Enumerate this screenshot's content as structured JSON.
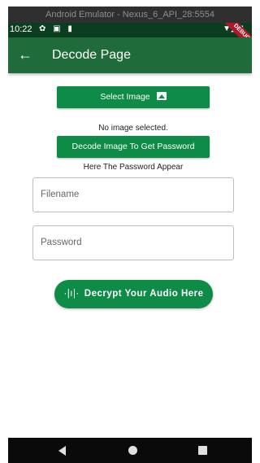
{
  "emulator": {
    "title": "Android Emulator - Nexus_6_API_28:5554"
  },
  "statusbar": {
    "time": "10:22",
    "icons": "✿ ▣ ▮",
    "right_icons": "▼◢ ▮",
    "debug_label": "DEBUG"
  },
  "appbar": {
    "back_icon": "←",
    "title": "Decode Page"
  },
  "select_button": {
    "label": "Select Image",
    "icon": "image-icon"
  },
  "no_image_text": "No image selected.",
  "decode_button": {
    "label": "Decode Image To Get Password"
  },
  "password_appear_text": "Here The Password Appear",
  "filename_field": {
    "placeholder": "Filename",
    "value": ""
  },
  "password_field": {
    "placeholder": "Password",
    "value": ""
  },
  "audio_button": {
    "icon": "·|ı|·",
    "label": "Decrypt Your Audio Here"
  },
  "colors": {
    "appbar": "#1f6b3a",
    "statusbar": "#0b3d21",
    "button": "#0e8b47",
    "navbar": "#0a0a0a"
  }
}
